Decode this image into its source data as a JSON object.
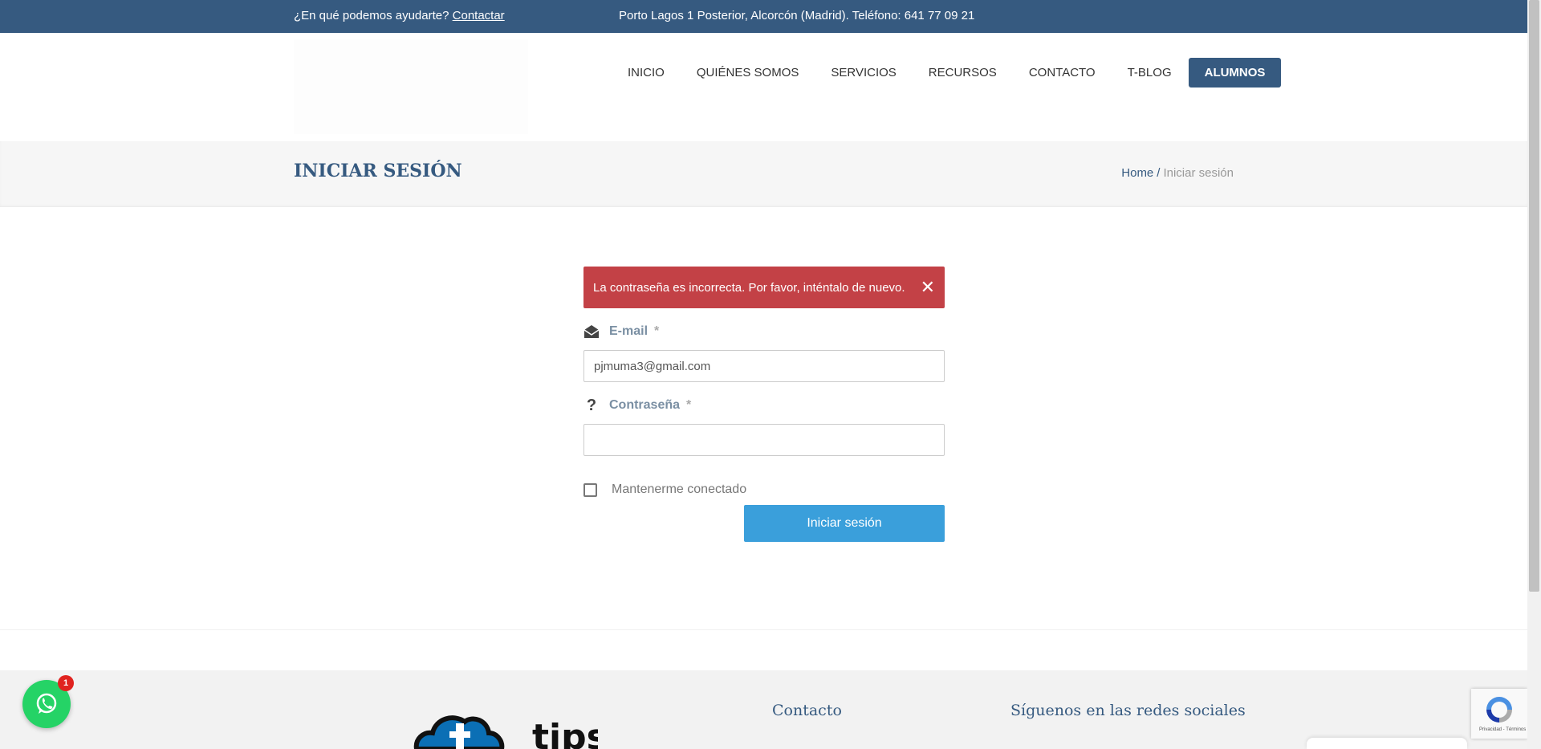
{
  "topbar": {
    "help_text": "¿En qué podemos ayudarte?",
    "contact_link": "Contactar",
    "address": "Porto Lagos 1 Posterior, Alcorcón (Madrid). Teléfono: 641 77 09 21"
  },
  "nav": {
    "items": [
      "INICIO",
      "QUIÉNES SOMOS",
      "SERVICIOS",
      "RECURSOS",
      "CONTACTO",
      "T-BLOG"
    ],
    "active": "ALUMNOS"
  },
  "page": {
    "title": "INICIAR SESIÓN",
    "breadcrumb": {
      "home": "Home",
      "separator": "/",
      "current": "Iniciar sesión"
    }
  },
  "login": {
    "error": "La contraseña es incorrecta. Por favor, inténtalo de nuevo.",
    "email_label": "E-mail",
    "email_value": "pjmuma3@gmail.com",
    "password_label": "Contraseña",
    "password_value": "",
    "required_mark": "*",
    "remember_label": "Mantenerme conectado",
    "submit_label": "Iniciar sesión"
  },
  "footer": {
    "logo_text": "tips",
    "contact_title": "Contacto",
    "social_title": "Síguenos en las redes sociales"
  },
  "widgets": {
    "whatsapp_badge": "1",
    "recaptcha_text": "Privacidad - Términos"
  },
  "colors": {
    "brand": "#365a80",
    "error": "#c34146",
    "button": "#3a9fdb",
    "whatsapp": "#25d366"
  }
}
